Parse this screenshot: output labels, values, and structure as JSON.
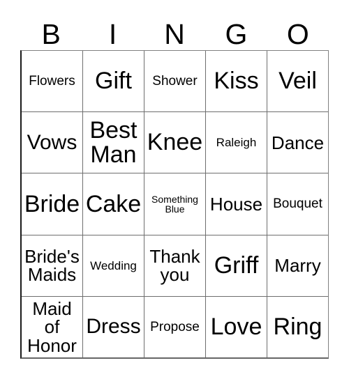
{
  "card": {
    "title": "BINGO",
    "columns": 5,
    "rows": 5,
    "header": [
      "B",
      "I",
      "N",
      "G",
      "O"
    ],
    "grid": [
      [
        {
          "text": "Flowers",
          "size": "sm"
        },
        {
          "text": "Gift",
          "size": "xl"
        },
        {
          "text": "Shower",
          "size": "sm"
        },
        {
          "text": "Kiss",
          "size": "xl"
        },
        {
          "text": "Veil",
          "size": "xl"
        }
      ],
      [
        {
          "text": "Vows",
          "size": "lg"
        },
        {
          "text": "Best Man",
          "size": "xl"
        },
        {
          "text": "Knee",
          "size": "xl"
        },
        {
          "text": "Raleigh",
          "size": "xs"
        },
        {
          "text": "Dance",
          "size": "md"
        }
      ],
      [
        {
          "text": "Bride",
          "size": "xl"
        },
        {
          "text": "Cake",
          "size": "xl"
        },
        {
          "text": "Something Blue",
          "size": "xxs"
        },
        {
          "text": "House",
          "size": "md"
        },
        {
          "text": "Bouquet",
          "size": "sm"
        }
      ],
      [
        {
          "text": "Bride's Maids",
          "size": "md"
        },
        {
          "text": "Wedding",
          "size": "xs"
        },
        {
          "text": "Thank you",
          "size": "md"
        },
        {
          "text": "Griff",
          "size": "xl"
        },
        {
          "text": "Marry",
          "size": "md"
        }
      ],
      [
        {
          "text": "Maid of Honor",
          "size": "md"
        },
        {
          "text": "Dress",
          "size": "lg"
        },
        {
          "text": "Propose",
          "size": "sm"
        },
        {
          "text": "Love",
          "size": "xl"
        },
        {
          "text": "Ring",
          "size": "xl"
        }
      ]
    ]
  },
  "colors": {
    "background": "#ffffff",
    "text": "#000000",
    "grid_line": "#6e6e6e",
    "grid_outer": "#1a1a1a"
  }
}
